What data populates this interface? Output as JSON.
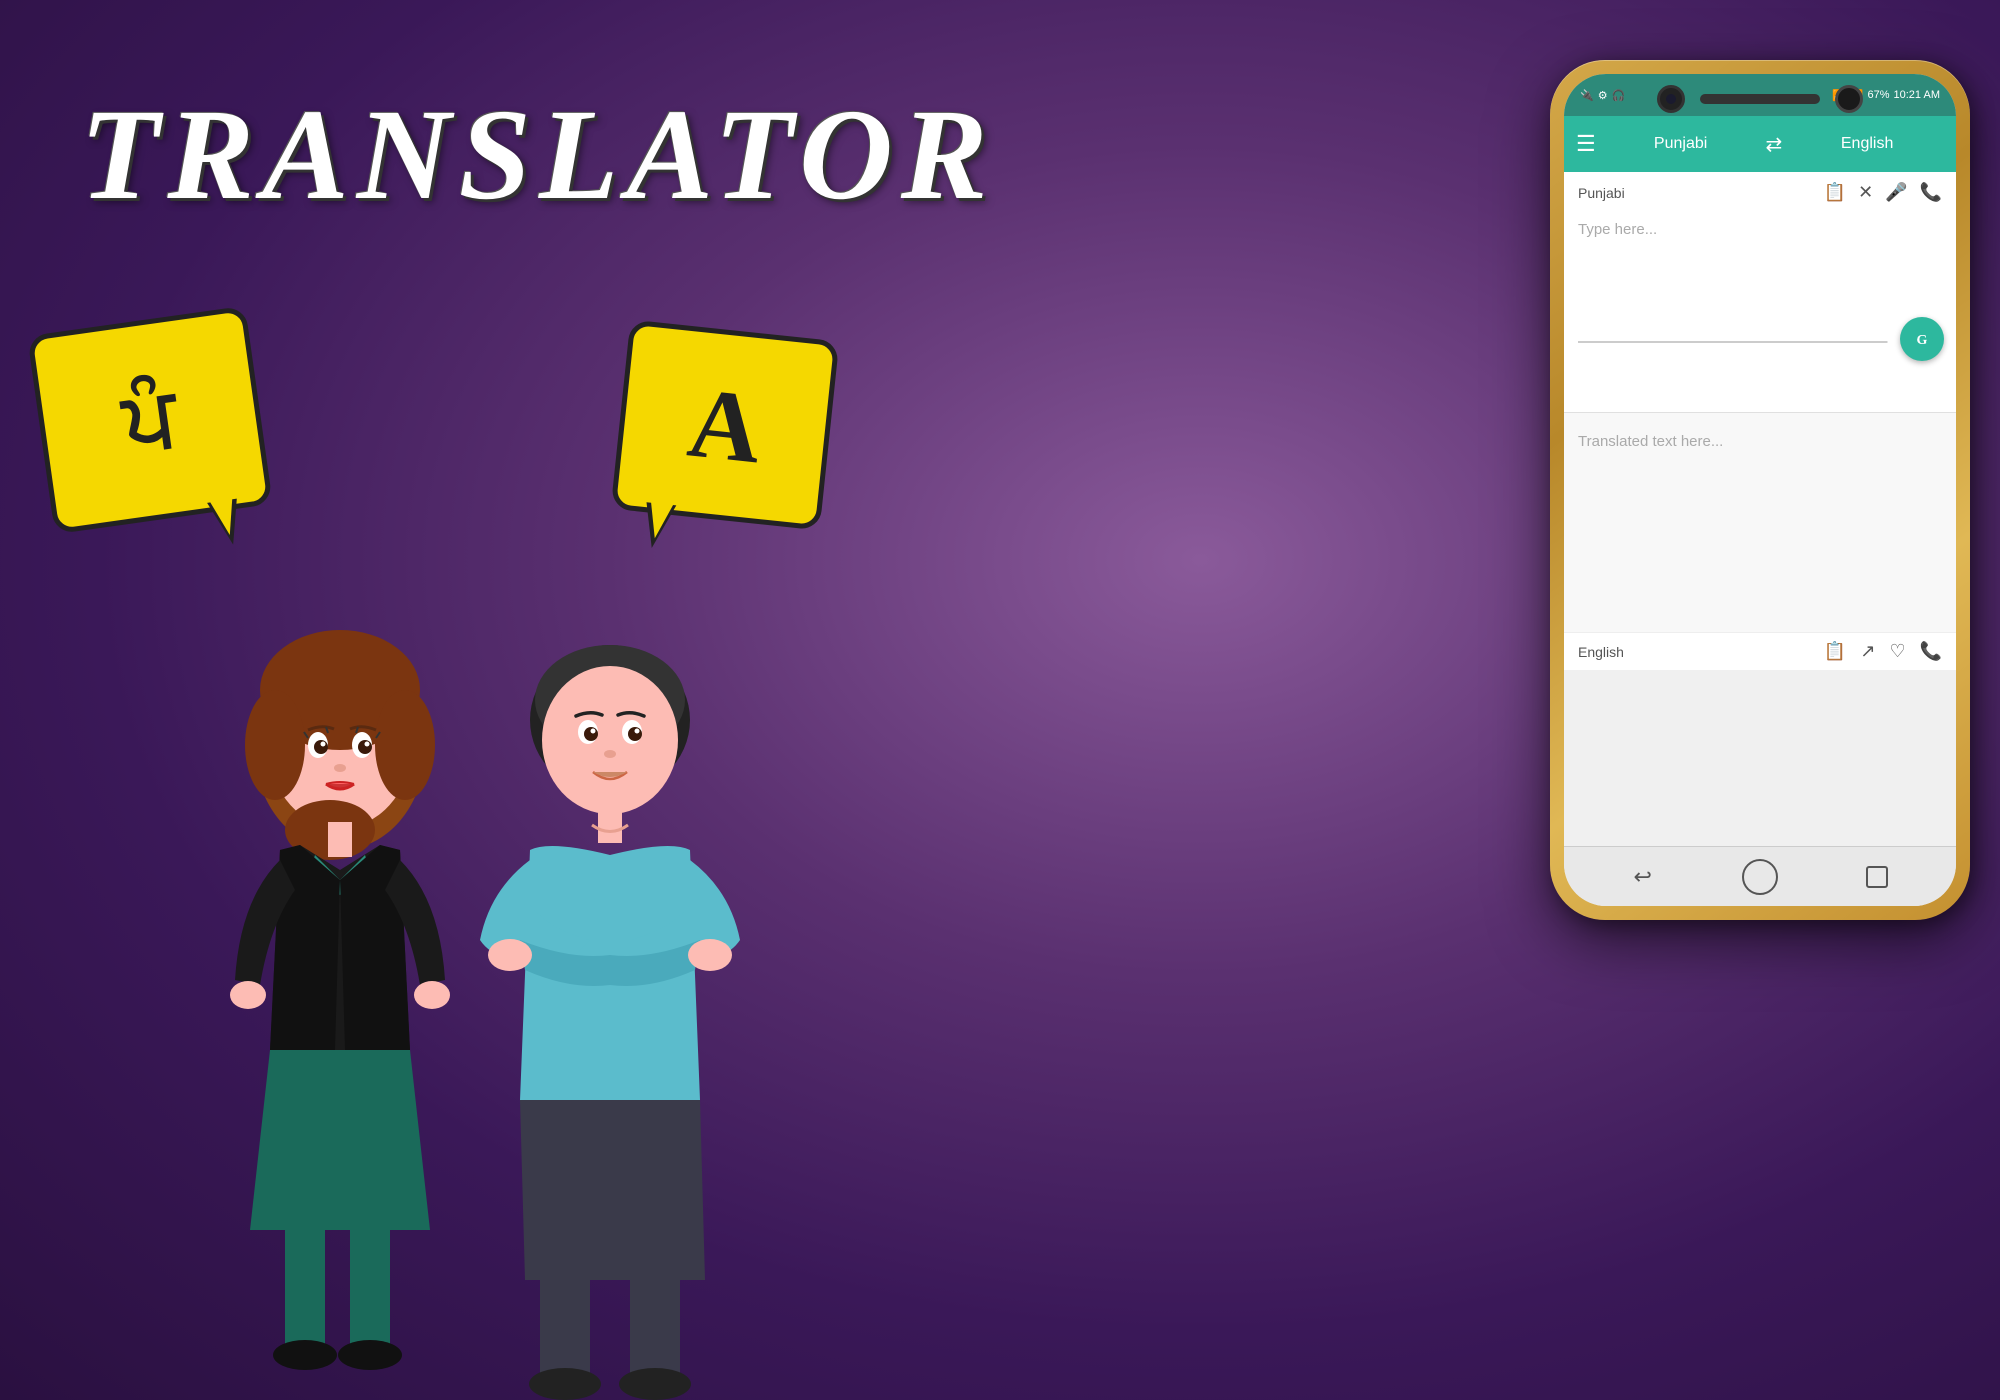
{
  "app": {
    "title": "TRANSLATOR",
    "background": "#5a3070"
  },
  "phone": {
    "status_bar": {
      "time": "10:21 AM",
      "battery": "67%",
      "signal": "Signal"
    },
    "toolbar": {
      "menu_icon": "☰",
      "source_lang": "Punjabi",
      "swap_icon": "⇄",
      "target_lang": "English"
    },
    "input_panel": {
      "language_label": "Punjabi",
      "placeholder": "Type here...",
      "icons": {
        "clipboard": "📋",
        "close": "✕",
        "mic": "🎤",
        "phone_input": "📞"
      }
    },
    "translate_button": {
      "icon": "G"
    },
    "output_panel": {
      "language_label": "English",
      "placeholder": "Translated text here...",
      "icons": {
        "copy": "📋",
        "share": "↗",
        "heart": "♡",
        "phone_output": "📞"
      }
    },
    "bottom_nav": {
      "back": "↩",
      "home": "⬜",
      "recent": "○"
    }
  },
  "bubbles": {
    "left": {
      "text": "ਪੰ",
      "color": "#f5d800"
    },
    "right": {
      "text": "A",
      "color": "#f5d800"
    }
  },
  "characters": {
    "female": {
      "description": "Female cartoon character with brown hair, black jacket, teal shirt"
    },
    "male": {
      "description": "Male cartoon character with dark hair, light blue shirt, arms crossed"
    }
  }
}
